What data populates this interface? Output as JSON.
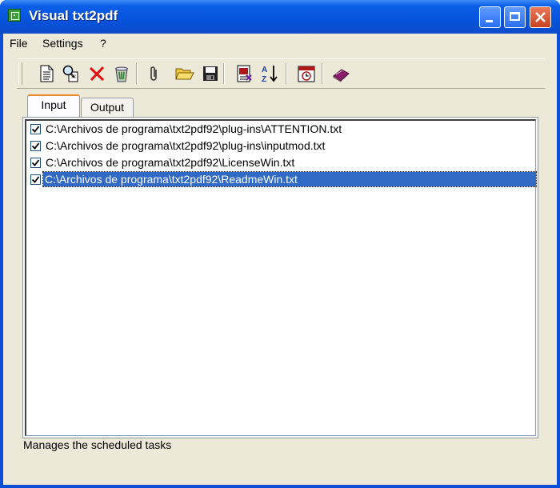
{
  "window": {
    "title": "Visual txt2pdf"
  },
  "menu": {
    "items": [
      "File",
      "Settings",
      "?"
    ]
  },
  "toolbar": {
    "buttons": [
      "new-file-icon",
      "find-files-icon",
      "delete-icon",
      "recycle-icon",
      "attach-icon",
      "open-folder-icon",
      "save-icon",
      "convert-pdf-icon",
      "sort-az-icon",
      "schedule-icon",
      "book-icon"
    ]
  },
  "tabs": [
    {
      "label": "Input",
      "selected": true
    },
    {
      "label": "Output",
      "selected": false
    }
  ],
  "file_list": [
    {
      "checked": true,
      "path": "C:\\Archivos de programa\\txt2pdf92\\plug-ins\\ATTENTION.txt",
      "selected": false
    },
    {
      "checked": true,
      "path": "C:\\Archivos de programa\\txt2pdf92\\plug-ins\\inputmod.txt",
      "selected": false
    },
    {
      "checked": true,
      "path": "C:\\Archivos de programa\\txt2pdf92\\LicenseWin.txt",
      "selected": false
    },
    {
      "checked": true,
      "path": "C:\\Archivos de programa\\txt2pdf92\\ReadmeWin.txt",
      "selected": true
    }
  ],
  "status": {
    "text": "Manages the scheduled tasks"
  },
  "colors": {
    "titlebar": "#0753dc",
    "selection": "#316ac5",
    "face": "#ece9d8",
    "close": "#c8421f"
  }
}
